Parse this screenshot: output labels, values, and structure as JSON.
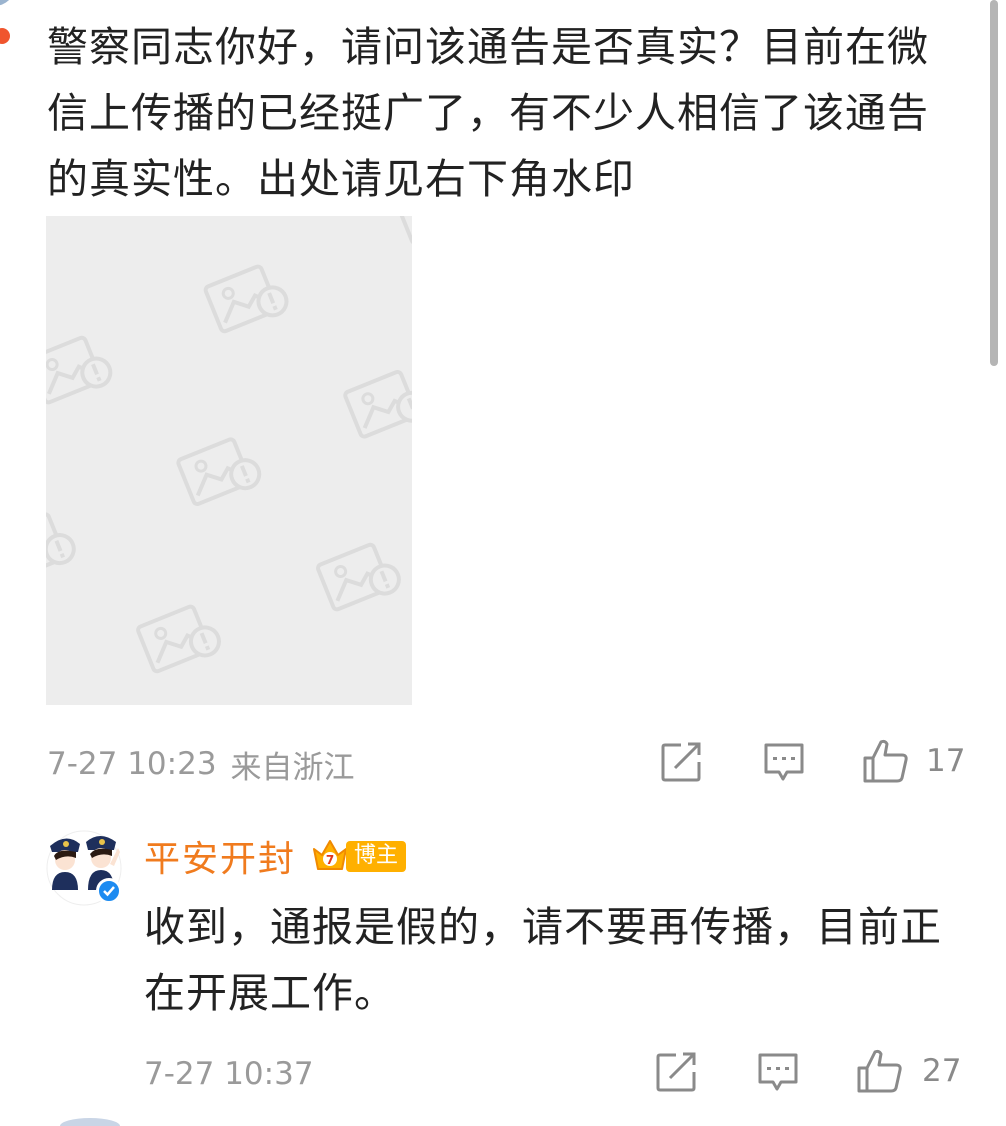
{
  "comment": {
    "text": "警察同志你好，请问该通告是否真实？目前在微信上传播的已经挺广了，有不少人相信了该通告的真实性。出处请见右下角水印",
    "image_icon": "image-placeholder-icon",
    "time": "7-27 10:23",
    "location": "来自浙江",
    "like_count": "17"
  },
  "reply": {
    "author": "平安开封",
    "badge_label": "博主",
    "text": "收到，通报是假的，请不要再传播，目前正在开展工作。",
    "time": "7-27 10:37",
    "like_count": "27"
  },
  "colors": {
    "accent_name": "#f07b1e",
    "badge": "#ffb000",
    "verified": "#1d8bf1",
    "meta_text": "#9a9a9a"
  }
}
